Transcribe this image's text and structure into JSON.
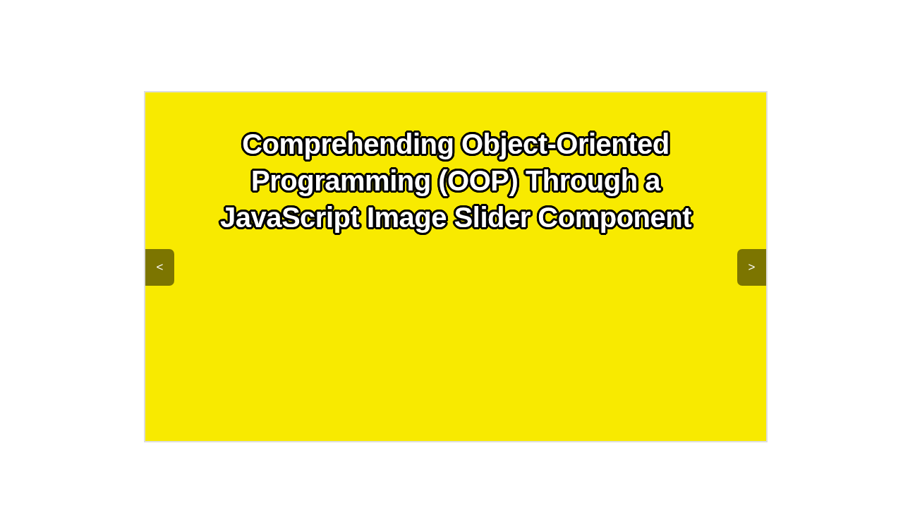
{
  "slider": {
    "slide": {
      "title": "Comprehending Object-Oriented Programming (OOP) Through a JavaScript Image Slider Component"
    },
    "prev_button": {
      "label": "<"
    },
    "next_button": {
      "label": ">"
    }
  }
}
